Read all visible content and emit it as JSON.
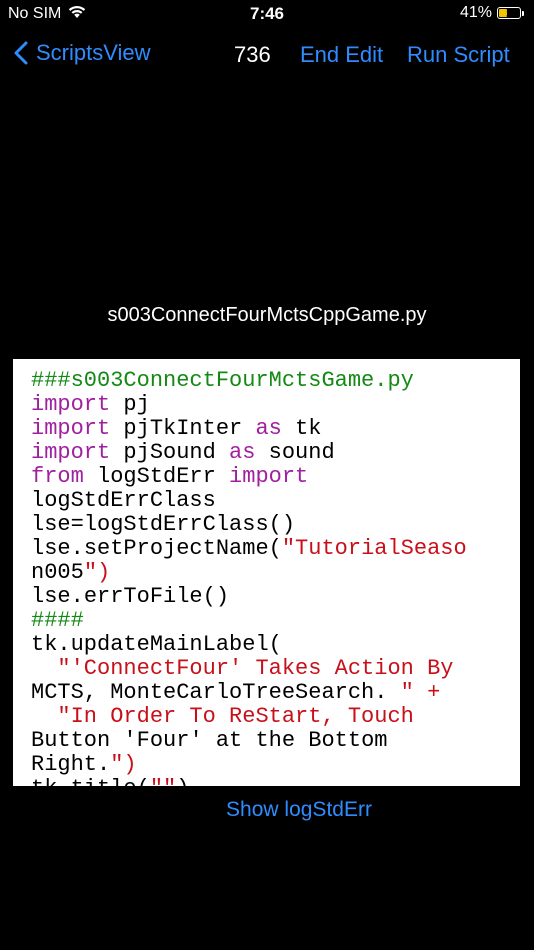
{
  "status": {
    "carrier": "No SIM",
    "time": "7:46",
    "battery_percent": "41%",
    "battery_level": 0.41,
    "battery_color": "#f2c400"
  },
  "nav": {
    "back_label": "ScriptsView",
    "count": "736",
    "end_edit": "End Edit",
    "run_script": "Run Script"
  },
  "file_name": "s003ConnectFourMctsCppGame.py",
  "code_lines": [
    "###s003ConnectFourMctsGame.py",
    "import pj",
    "import pjTkInter as tk",
    "import pjSound as sound",
    "from logStdErr import",
    "logStdErrClass",
    "lse=logStdErrClass()",
    "lse.setProjectName(\"TutorialSeaso",
    "n005\")",
    "lse.errToFile()",
    "####",
    "tk.updateMainLabel(",
    "  \"'ConnectFour' Takes Action By",
    "MCTS, MonteCarloTreeSearch. \" +",
    "  \"In Order To ReStart, Touch",
    "Button 'Four' at the Bottom",
    "Right.\")",
    "tk.title(\"\")"
  ],
  "show_log_label": "Show logStdErr",
  "colors": {
    "accent": "#2f8cff",
    "comment": "#138a13",
    "keyword": "#a0209f",
    "string": "#c8101a"
  }
}
